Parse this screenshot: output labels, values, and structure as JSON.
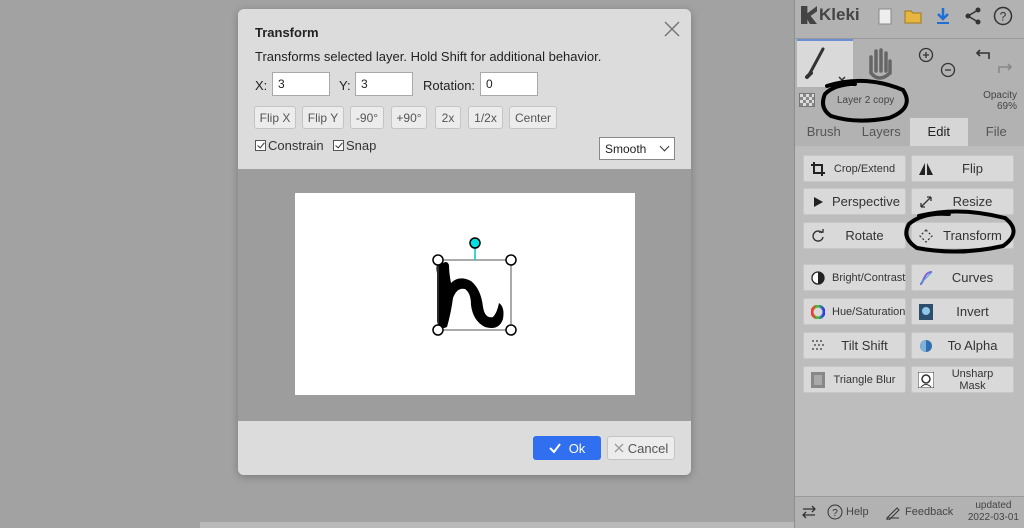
{
  "app": {
    "name": "Kleki"
  },
  "sidebar": {
    "layer": {
      "name": "Layer 2 copy",
      "opacity_label": "Opacity",
      "opacity_value": "69%"
    },
    "tabs": [
      {
        "label": "Brush"
      },
      {
        "label": "Layers"
      },
      {
        "label": "Edit",
        "active": true
      },
      {
        "label": "File"
      }
    ],
    "edit_buttons": [
      {
        "label": "Crop/Extend",
        "icon": "crop-icon"
      },
      {
        "label": "Flip",
        "icon": "flip-icon"
      },
      {
        "label": "Perspective",
        "icon": "perspective-icon"
      },
      {
        "label": "Resize",
        "icon": "resize-icon"
      },
      {
        "label": "Rotate",
        "icon": "rotate-icon"
      },
      {
        "label": "Transform",
        "icon": "transform-icon"
      },
      {
        "label": "Bright/Contrast",
        "icon": "brightness-icon"
      },
      {
        "label": "Curves",
        "icon": "curves-icon"
      },
      {
        "label": "Hue/Saturation",
        "icon": "hue-icon"
      },
      {
        "label": "Invert",
        "icon": "invert-icon"
      },
      {
        "label": "Tilt Shift",
        "icon": "tilt-shift-icon"
      },
      {
        "label": "To Alpha",
        "icon": "to-alpha-icon"
      },
      {
        "label": "Triangle Blur",
        "icon": "blur-icon"
      },
      {
        "label": "Unsharp Mask",
        "icon": "unsharp-icon"
      }
    ],
    "bottom": {
      "help": "Help",
      "feedback": "Feedback",
      "updated_label": "updated",
      "updated_date": "2022-03-01"
    }
  },
  "modal": {
    "title": "Transform",
    "description": "Transforms selected layer. Hold Shift for additional behavior.",
    "x_label": "X:",
    "x_value": "3",
    "y_label": "Y:",
    "y_value": "3",
    "rotation_label": "Rotation:",
    "rotation_value": "0",
    "buttons": [
      "Flip X",
      "Flip Y",
      "-90°",
      "+90°",
      "2x",
      "1/2x",
      "Center"
    ],
    "constrain_label": "Constrain",
    "snap_label": "Snap",
    "interpolation": "Smooth",
    "ok_label": "Ok",
    "cancel_label": "Cancel"
  },
  "colors": {
    "accent": "#2f6ff0",
    "handle_cyan": "#00e0e0"
  }
}
